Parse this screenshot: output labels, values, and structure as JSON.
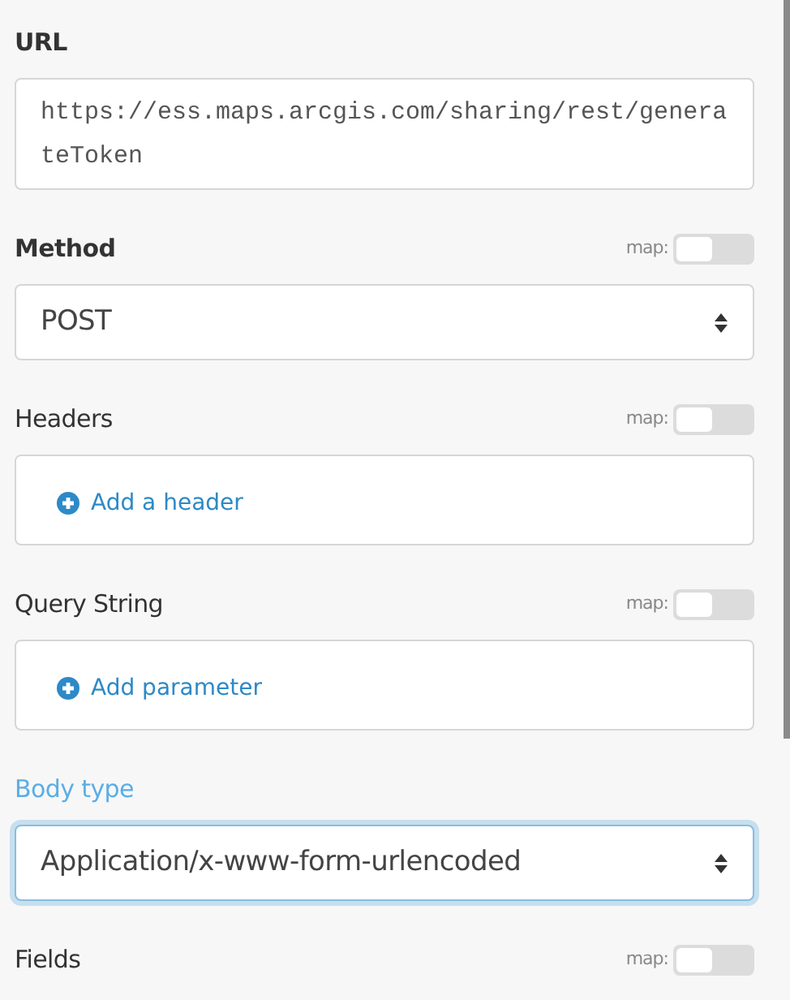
{
  "sections": [
    {
      "kind": "url",
      "label": "URL",
      "bold": true,
      "value": "https://ess.maps.arcgis.com/sharing/rest/generateToken"
    },
    {
      "kind": "select",
      "label": "Method",
      "bold": true,
      "map_toggle": {
        "label": "map:",
        "on": false
      },
      "value": "POST",
      "focused": false
    },
    {
      "kind": "list",
      "label": "Headers",
      "bold": false,
      "map_toggle": {
        "label": "map:",
        "on": false
      },
      "action": "Add a header"
    },
    {
      "kind": "list",
      "label": "Query String",
      "bold": false,
      "map_toggle": {
        "label": "map:",
        "on": false
      },
      "action": "Add parameter"
    },
    {
      "kind": "select",
      "label": "Body type",
      "bold": false,
      "value": "Application/x-www-form-urlencoded",
      "focused": true
    },
    {
      "kind": "heading",
      "label": "Fields",
      "bold": false,
      "map_toggle": {
        "label": "map:",
        "on": false
      }
    }
  ]
}
